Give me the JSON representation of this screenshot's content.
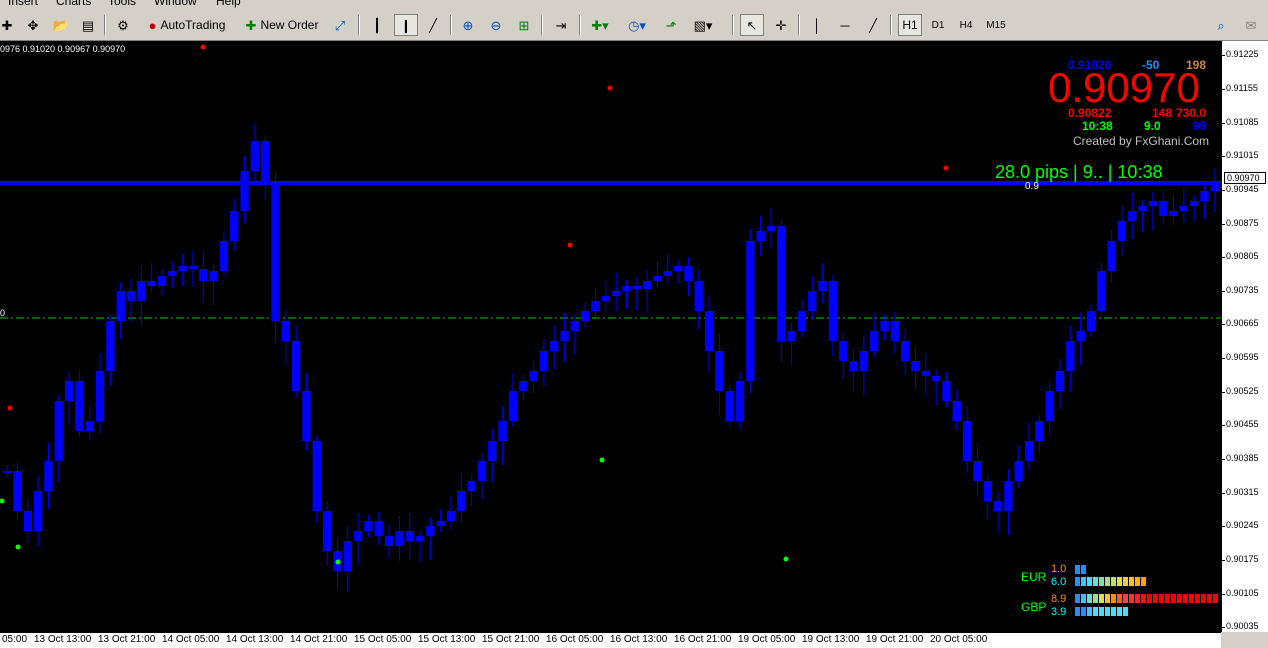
{
  "menu": [
    "Insert",
    "Charts",
    "Tools",
    "Window",
    "Help"
  ],
  "toolbar": {
    "autotrading_label": "AutoTrading",
    "new_order_label": "New Order",
    "timeframes": [
      "H1",
      "D1",
      "H4",
      "M15"
    ]
  },
  "chart": {
    "ohlc_text": "0976 0.91020 0.90967 0.90970",
    "zero_label": "0",
    "pips_text": "28.0 pips | 9.. | 10:38",
    "spread_label": "0.9",
    "level_color": "#0000ff",
    "dash_line_color": "#00ff00"
  },
  "info_panel": {
    "high": "0.91020",
    "high_color": "#0000ff",
    "change": "-50",
    "change_color": "#1e90ff",
    "range": "198",
    "range_color": "#cd853f",
    "price": "0.90970",
    "price_color": "#ff0000",
    "low": "0.90822",
    "value2": "148",
    "value3": "730.0",
    "time": "10:38",
    "spread": "9.0",
    "value4": "99",
    "credit": "Created by FxGhani.Com"
  },
  "strength": {
    "eur_label": "EUR",
    "eur_val1": "1.0",
    "eur_val2": "6.0",
    "gbp_label": "GBP",
    "gbp_val1": "8.9",
    "gbp_val2": "3.9"
  },
  "yaxis": {
    "ticks": [
      "0.91225",
      "0.91155",
      "0.91085",
      "0.91015",
      "0.90945",
      "0.90875",
      "0.90805",
      "0.90735",
      "0.90665",
      "0.90595",
      "0.90525",
      "0.90455",
      "0.90385",
      "0.90315",
      "0.90245",
      "0.90175",
      "0.90105",
      "0.90035"
    ],
    "current": "0.90970"
  },
  "xaxis": {
    "labels": [
      "05:00",
      "13 Oct 13:00",
      "13 Oct 21:00",
      "14 Oct 05:00",
      "14 Oct 13:00",
      "14 Oct 21:00",
      "15 Oct 05:00",
      "15 Oct 13:00",
      "15 Oct 21:00",
      "16 Oct 05:00",
      "16 Oct 13:00",
      "16 Oct 21:00",
      "19 Oct 05:00",
      "19 Oct 13:00",
      "19 Oct 21:00",
      "20 Oct 05:00"
    ]
  },
  "icons": [
    "zoom-in-icon",
    "zoom-out-icon",
    "crosshair-icon",
    "cursor-icon",
    "search-icon",
    "chat-icon"
  ]
}
